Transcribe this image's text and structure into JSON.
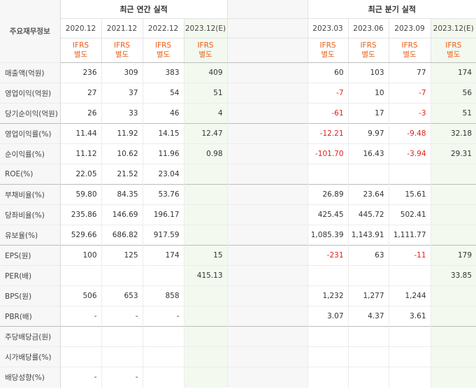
{
  "header": {
    "label_column": "주요재무정보",
    "annual_group": "최근 연간 실적",
    "quarter_group": "최근 분기 실적",
    "annual_periods": [
      "2020.12",
      "2021.12",
      "2022.12",
      "2023.12(E)"
    ],
    "quarter_periods": [
      "2023.03",
      "2023.06",
      "2023.09",
      "2023.12(E)"
    ],
    "ifrs_top": "IFRS",
    "ifrs_bottom": "별도"
  },
  "rows": [
    {
      "label": "매출액(억원)",
      "annual": [
        "236",
        "309",
        "383",
        "409"
      ],
      "quarter": [
        "60",
        "103",
        "77",
        "174"
      ]
    },
    {
      "label": "영업이익(억원)",
      "annual": [
        "27",
        "37",
        "54",
        "51"
      ],
      "quarter": [
        "-7",
        "10",
        "-7",
        "56"
      ]
    },
    {
      "label": "당기순이익(억원)",
      "annual": [
        "26",
        "33",
        "46",
        "4"
      ],
      "quarter": [
        "-61",
        "17",
        "-3",
        "51"
      ]
    },
    {
      "label": "영업이익률(%)",
      "annual": [
        "11.44",
        "11.92",
        "14.15",
        "12.47"
      ],
      "quarter": [
        "-12.21",
        "9.97",
        "-9.48",
        "32.18"
      ]
    },
    {
      "label": "순이익률(%)",
      "annual": [
        "11.12",
        "10.62",
        "11.96",
        "0.98"
      ],
      "quarter": [
        "-101.70",
        "16.43",
        "-3.94",
        "29.31"
      ]
    },
    {
      "label": "ROE(%)",
      "annual": [
        "22.05",
        "21.52",
        "23.04",
        ""
      ],
      "quarter": [
        "",
        "",
        "",
        ""
      ]
    },
    {
      "label": "부채비율(%)",
      "annual": [
        "59.80",
        "84.35",
        "53.76",
        ""
      ],
      "quarter": [
        "26.89",
        "23.64",
        "15.61",
        ""
      ]
    },
    {
      "label": "당좌비율(%)",
      "annual": [
        "235.86",
        "146.69",
        "196.17",
        ""
      ],
      "quarter": [
        "425.45",
        "445.72",
        "502.41",
        ""
      ]
    },
    {
      "label": "유보율(%)",
      "annual": [
        "529.66",
        "686.82",
        "917.59",
        ""
      ],
      "quarter": [
        "1,085.39",
        "1,143.91",
        "1,111.77",
        ""
      ]
    },
    {
      "label": "EPS(원)",
      "annual": [
        "100",
        "125",
        "174",
        "15"
      ],
      "quarter": [
        "-231",
        "63",
        "-11",
        "179"
      ]
    },
    {
      "label": "PER(배)",
      "annual": [
        "",
        "",
        "",
        "415.13"
      ],
      "quarter": [
        "",
        "",
        "",
        "33.85"
      ]
    },
    {
      "label": "BPS(원)",
      "annual": [
        "506",
        "653",
        "858",
        ""
      ],
      "quarter": [
        "1,232",
        "1,277",
        "1,244",
        ""
      ]
    },
    {
      "label": "PBR(배)",
      "annual": [
        "-",
        "-",
        "-",
        ""
      ],
      "quarter": [
        "3.07",
        "4.37",
        "3.61",
        ""
      ]
    },
    {
      "label": "주당배당금(원)",
      "annual": [
        "",
        "",
        "",
        ""
      ],
      "quarter": [
        "",
        "",
        "",
        ""
      ]
    },
    {
      "label": "시가배당률(%)",
      "annual": [
        "",
        "",
        "",
        ""
      ],
      "quarter": [
        "",
        "",
        "",
        ""
      ]
    },
    {
      "label": "배당성향(%)",
      "annual": [
        "-",
        "-",
        "",
        ""
      ],
      "quarter": [
        "",
        "",
        "",
        ""
      ]
    }
  ],
  "colors": {
    "ifrs_text": "#e8601a",
    "negative_text": "#e0201a",
    "estimate_bg": "#f3f9ef",
    "label_bg": "#f7f7f7"
  }
}
